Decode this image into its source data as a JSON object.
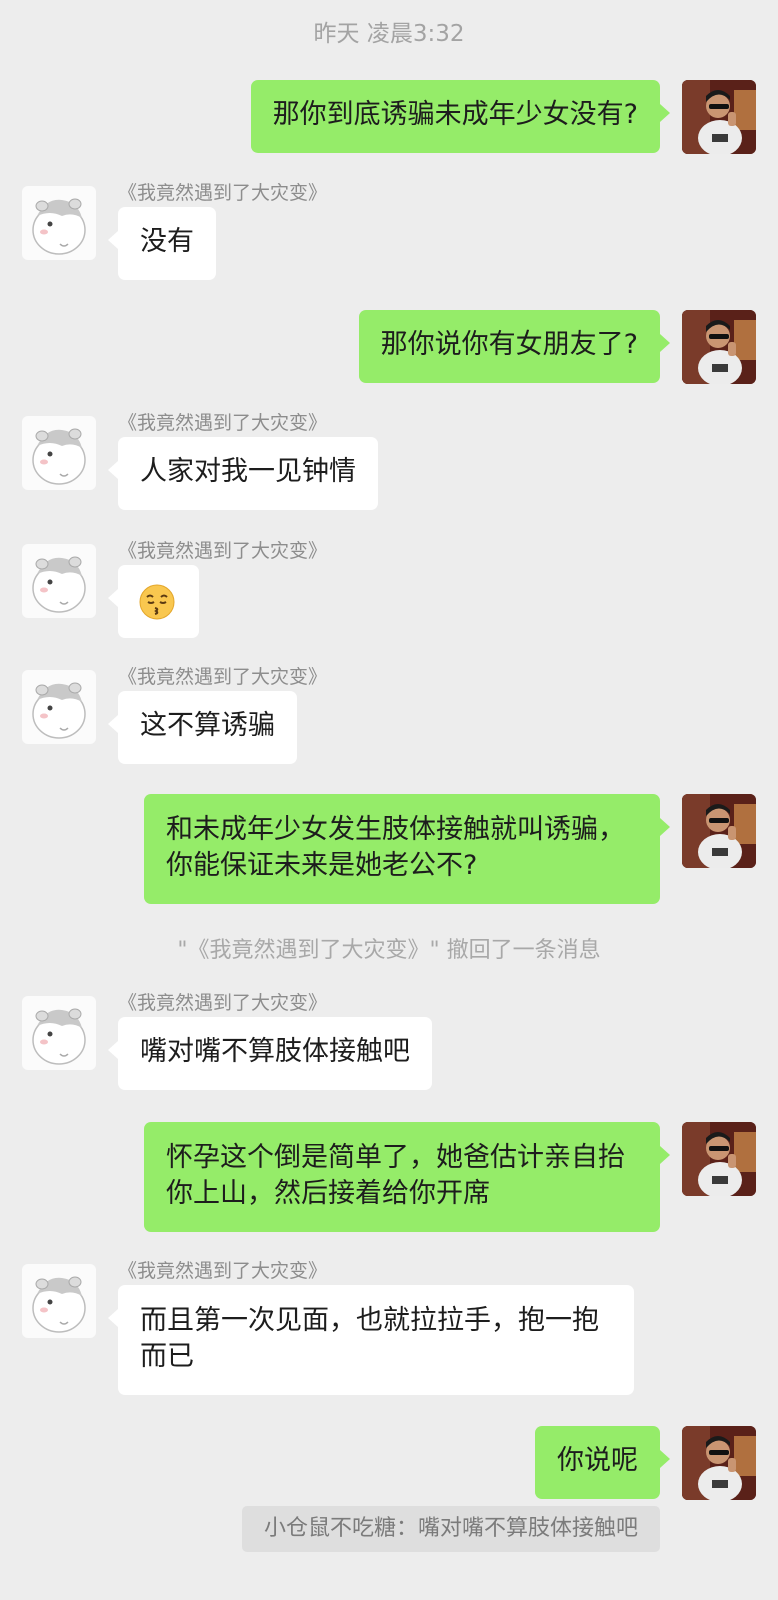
{
  "chat": {
    "timestamp": "昨天 凌晨3:32",
    "messages": [
      {
        "side": "out",
        "text": "那你到底诱骗未成年少女没有?"
      },
      {
        "side": "in",
        "sender": "《我竟然遇到了大灾变》",
        "text": "没有"
      },
      {
        "side": "out",
        "text": "那你说你有女朋友了?"
      },
      {
        "side": "in",
        "sender": "《我竟然遇到了大灾变》",
        "text": "人家对我一见钟情"
      },
      {
        "side": "in",
        "sender": "《我竟然遇到了大灾变》",
        "emoji": "😙"
      },
      {
        "side": "in",
        "sender": "《我竟然遇到了大灾变》",
        "text": "这不算诱骗"
      },
      {
        "side": "out",
        "text": "和未成年少女发生肢体接触就叫诱骗，你能保证未来是她老公不?"
      },
      {
        "side": "in",
        "sender": "《我竟然遇到了大灾变》",
        "text": "嘴对嘴不算肢体接触吧"
      },
      {
        "side": "out",
        "text": "怀孕这个倒是简单了，她爸估计亲自抬你上山，然后接着给你开席"
      },
      {
        "side": "in",
        "sender": "《我竟然遇到了大灾变》",
        "text": "而且第一次见面，也就拉拉手，抱一抱而已"
      },
      {
        "side": "out",
        "text": "你说呢"
      }
    ],
    "recall_notice": "\"《我竟然遇到了大灾变》\" 撤回了一条消息",
    "quote_reply": "小仓鼠不吃糖：嘴对嘴不算肢体接触吧"
  },
  "icons": {
    "incoming_avatar": "hamster-avatar-icon",
    "outgoing_avatar": "user-photo-avatar-icon"
  },
  "colors": {
    "background": "#ededed",
    "incoming_bubble": "#ffffff",
    "outgoing_bubble": "#95ec69",
    "system_text": "#a8a8a8"
  }
}
